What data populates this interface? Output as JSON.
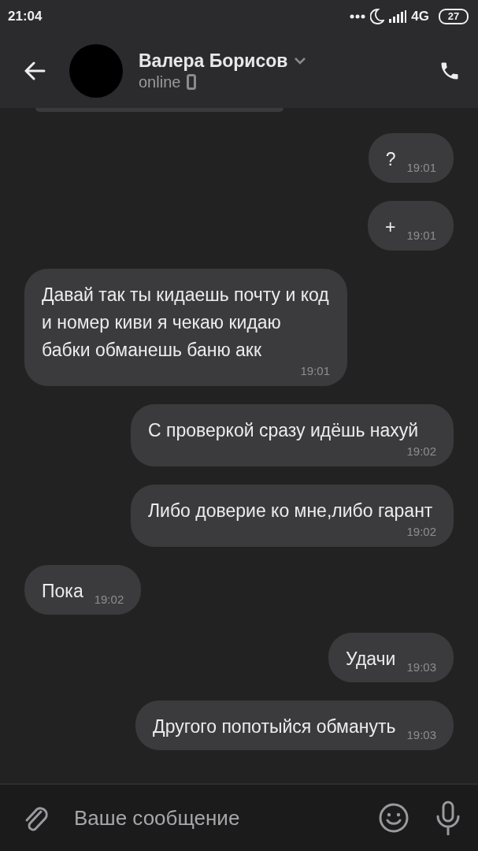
{
  "status_bar": {
    "time": "21:04",
    "network": "4G",
    "battery": "27"
  },
  "header": {
    "name": "Валера Борисов",
    "status": "online"
  },
  "messages": [
    {
      "kind": "outgoing",
      "text": "?",
      "time": "19:01"
    },
    {
      "kind": "outgoing",
      "text": "+",
      "time": "19:01"
    },
    {
      "kind": "incoming",
      "text": "Давай так ты кидаешь почту и код и номер киви я чекаю кидаю бабки обманешь баню акк",
      "time": "19:01"
    },
    {
      "kind": "outgoing",
      "text": "С проверкой сразу идёшь нахуй",
      "time": "19:02"
    },
    {
      "kind": "outgoing",
      "text": "Либо доверие ко мне,либо гарант",
      "time": "19:02"
    },
    {
      "kind": "incoming",
      "text": "Пока",
      "time": "19:02"
    },
    {
      "kind": "outgoing",
      "text": "Удачи",
      "time": "19:03"
    },
    {
      "kind": "outgoing",
      "text": "Другого попотыйся обмануть",
      "time": "19:03"
    }
  ],
  "composer": {
    "placeholder": "Ваше сообщение"
  }
}
